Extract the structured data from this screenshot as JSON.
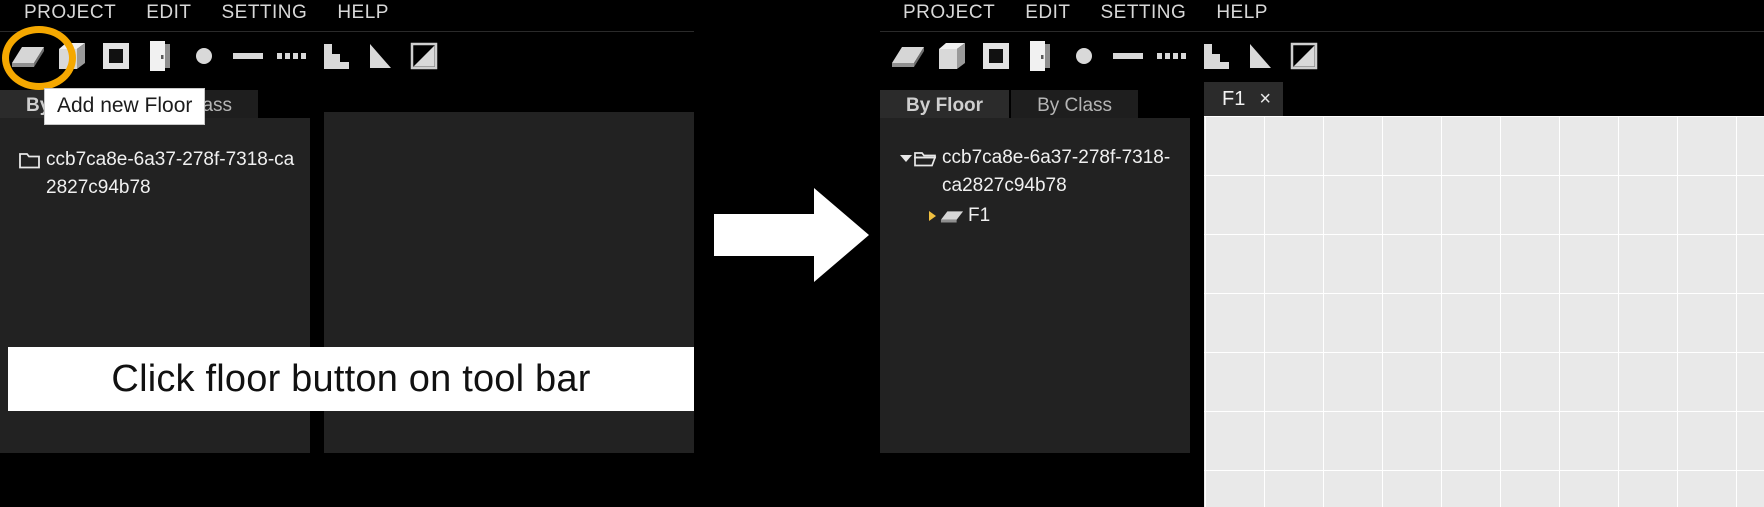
{
  "app": {
    "menu": [
      "PROJECT",
      "EDIT",
      "SETTING",
      "HELP"
    ],
    "toolbar_icons": [
      "floor-slab-icon",
      "wall-cube-icon",
      "window-icon",
      "door-icon",
      "column-icon",
      "beam-icon",
      "railing-icon",
      "stair-icon",
      "ramp-icon",
      "roof-icon"
    ],
    "colors": {
      "highlight_ring": "#f5a800",
      "panel_bg": "#222222",
      "tab_active_bg": "#2b2b2b",
      "tab_inactive_bg": "#1e1e1e",
      "canvas_bg": "#e9e9e9",
      "grid_line": "#ffffff",
      "app_bg": "#000000",
      "text": "#f0f0f0"
    }
  },
  "before": {
    "tooltip": "Add new Floor",
    "tabs": [
      {
        "label": "By Floor",
        "active": true
      },
      {
        "label": "By Class",
        "active": false
      }
    ],
    "tree": [
      {
        "label": "ccb7ca8e-6a37-278f-7318-ca2827c94b78",
        "icon": "folder-icon",
        "twisty": "none",
        "depth": 0
      }
    ]
  },
  "after": {
    "tabs": [
      {
        "label": "By Floor",
        "active": true
      },
      {
        "label": "By Class",
        "active": false
      }
    ],
    "tree": [
      {
        "label": "ccb7ca8e-6a37-278f-7318-ca2827c94b78",
        "icon": "folder-open-icon",
        "twisty": "expanded",
        "depth": 0
      },
      {
        "label": "F1",
        "icon": "floor-slab-icon",
        "twisty": "collapsed",
        "depth": 1
      }
    ],
    "document_tab": {
      "label": "F1",
      "close_label": "×"
    }
  },
  "caption": "Click floor button on tool bar",
  "arrow": {
    "name": "right-arrow-icon",
    "color": "#ffffff"
  }
}
